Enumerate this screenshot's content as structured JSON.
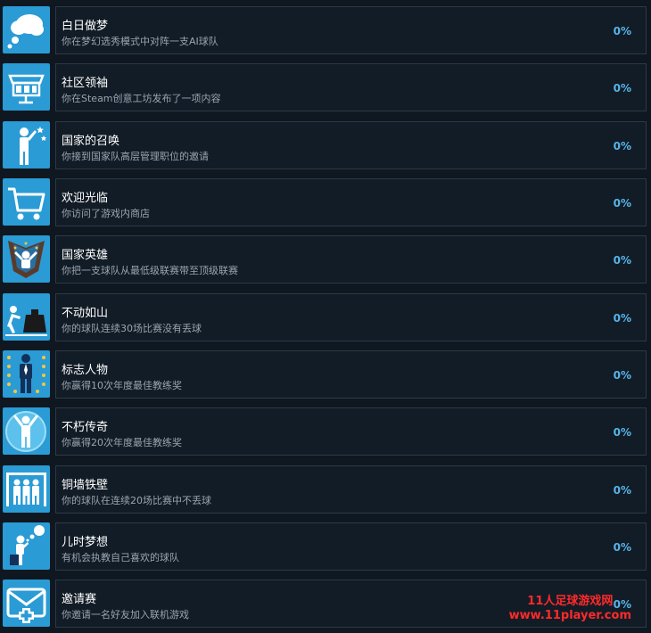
{
  "achievements": [
    {
      "title": "白日做梦",
      "description": "你在梦幻选秀模式中对阵一支AI球队",
      "percent": "0%",
      "icon": "thought-bubble-icon"
    },
    {
      "title": "社区领袖",
      "description": "你在Steam创意工坊发布了一项内容",
      "percent": "0%",
      "icon": "workshop-stall-icon"
    },
    {
      "title": "国家的召唤",
      "description": "你接到国家队高层管理职位的邀请",
      "percent": "0%",
      "icon": "salute-person-icon"
    },
    {
      "title": "欢迎光临",
      "description": "你访问了游戏内商店",
      "percent": "0%",
      "icon": "shopping-cart-icon"
    },
    {
      "title": "国家英雄",
      "description": "你把一支球队从最低级联赛带至顶级联赛",
      "percent": "0%",
      "icon": "hero-cape-icon"
    },
    {
      "title": "不动如山",
      "description": "你的球队连续30场比赛没有丢球",
      "percent": "0%",
      "icon": "weight-push-icon"
    },
    {
      "title": "标志人物",
      "description": "你赢得10次年度最佳教练奖",
      "percent": "0%",
      "icon": "suited-figure-stars-icon"
    },
    {
      "title": "不朽传奇",
      "description": "你赢得20次年度最佳教练奖",
      "percent": "0%",
      "icon": "celebrating-figure-icon"
    },
    {
      "title": "铜墙铁壁",
      "description": "你的球队在连续20场比赛中不丢球",
      "percent": "0%",
      "icon": "defensive-wall-icon"
    },
    {
      "title": "儿时梦想",
      "description": "有机会执教自己喜欢的球队",
      "percent": "0%",
      "icon": "dreaming-child-icon"
    },
    {
      "title": "邀请赛",
      "description": "你邀请一名好友加入联机游戏",
      "percent": "0%",
      "icon": "envelope-plus-icon"
    }
  ],
  "watermark": {
    "line1": "11人足球游戏网",
    "line2": "www.11player.com"
  },
  "colors": {
    "icon_bg": "#2a9bd4",
    "percent": "#56b4ea",
    "watermark": "#ff2a2a"
  }
}
